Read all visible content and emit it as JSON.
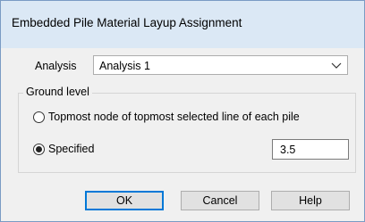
{
  "dialog": {
    "title": "Embedded Pile Material Layup Assignment"
  },
  "analysis": {
    "label": "Analysis",
    "selected": "Analysis 1"
  },
  "ground_level": {
    "legend": "Ground level",
    "options": [
      {
        "label": "Topmost node of topmost selected line of each pile",
        "selected": false
      },
      {
        "label": "Specified",
        "selected": true
      }
    ],
    "specified_value": "3.5"
  },
  "buttons": {
    "ok": "OK",
    "cancel": "Cancel",
    "help": "Help"
  },
  "icons": {
    "dropdown": "chevron-down-icon"
  }
}
